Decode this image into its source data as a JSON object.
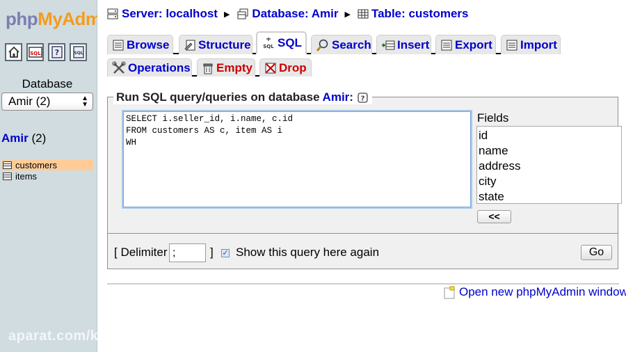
{
  "left": {
    "logo_part1": "php",
    "logo_part2": "MyAdm",
    "nav_icons": [
      "home-icon",
      "sql-query-icon",
      "help-icon",
      "docs-icon"
    ],
    "database_label": "Database",
    "database_select_value": "Amir (2)",
    "current_db_name": "Amir",
    "current_db_count": "(2)",
    "tables": [
      {
        "name": "customers",
        "active": true
      },
      {
        "name": "items",
        "active": false
      }
    ],
    "watermark": "aparat.com/kitandroid"
  },
  "breadcrumb": {
    "server": "Server: localhost",
    "database": "Database: Amir",
    "table": "Table: customers"
  },
  "tabs_row1": [
    "Browse",
    "Structure",
    "SQL",
    "Search",
    "Insert",
    "Export",
    "Import"
  ],
  "tabs_row2": [
    "Operations",
    "Empty",
    "Drop"
  ],
  "active_tab": "SQL",
  "query": {
    "legend_prefix": "Run SQL query/queries on database",
    "legend_db": "Amir",
    "legend_suffix": ":",
    "sql_text": "SELECT i.seller_id, i.name, c.id\nFROM customers AS c, item AS i\nWH",
    "fields_label": "Fields",
    "fields": [
      "id",
      "name",
      "address",
      "city",
      "state"
    ],
    "insert_button": "<<"
  },
  "options": {
    "delimiter_open": "[ Delimiter",
    "delimiter_value": ";",
    "delimiter_close": "]",
    "show_again_label": "Show this query here again",
    "show_again_checked": true,
    "go_button": "Go"
  },
  "footer": {
    "open_new_window": "Open new phpMyAdmin window"
  },
  "colors": {
    "link_blue": "#0000cc",
    "danger_red": "#cc0000",
    "left_bg": "#d0dce0",
    "active_row": "#ffcc99"
  }
}
